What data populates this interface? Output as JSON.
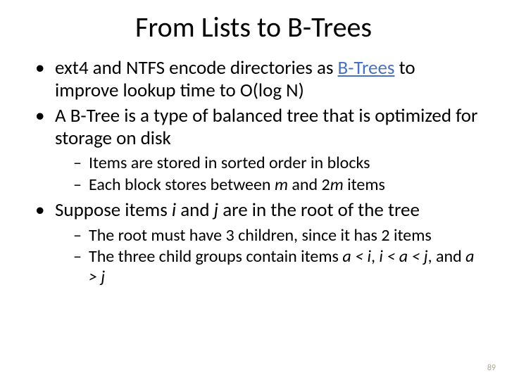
{
  "title": "From Lists to B-Trees",
  "b1_pre": "ext4 and NTFS encode directories as ",
  "b1_link": "B-Trees",
  "b1_post": " to improve lookup time to O(log N)",
  "b2": "A B-Tree is a type of balanced tree that is optimized for storage on disk",
  "b2_s1": "Items are stored in sorted order in blocks",
  "b2_s2_a": "Each block stores between ",
  "b2_s2_m": "m",
  "b2_s2_b": " and 2",
  "b2_s2_m2": "m",
  "b2_s2_c": " items",
  "b3_a": "Suppose items ",
  "b3_i": "i",
  "b3_b": " and ",
  "b3_j": "j",
  "b3_c": " are in the root of the tree",
  "b3_s1": "The root must have 3 children, since it has 2 items",
  "b3_s2_a": "The three child groups contain items ",
  "b3_s2_e1": "a < i",
  "b3_s2_b": ", ",
  "b3_s2_e2": "i < a < j",
  "b3_s2_c": ", and ",
  "b3_s2_e3": "a > j",
  "page": "89"
}
